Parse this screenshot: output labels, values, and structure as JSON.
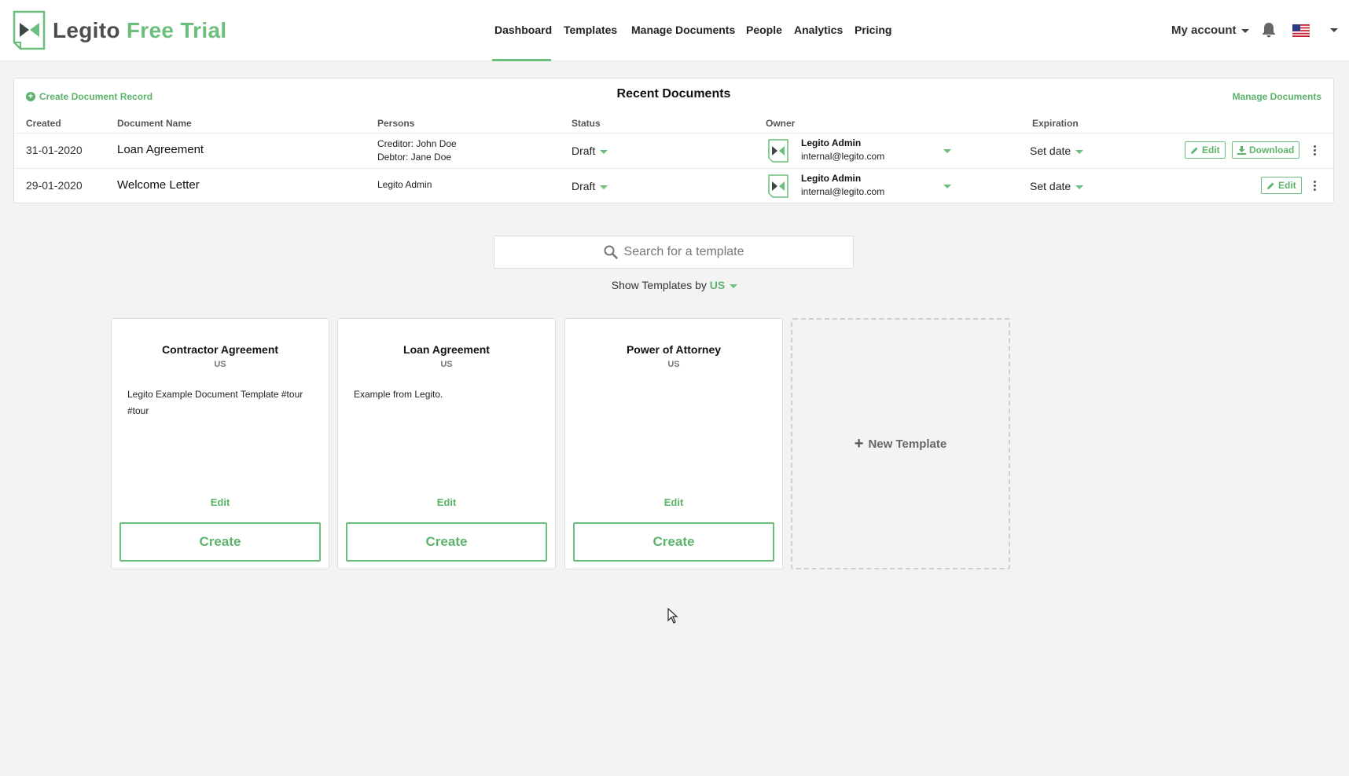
{
  "header": {
    "logo_primary": "Legito",
    "logo_secondary": "Free Trial",
    "nav": [
      {
        "label": "Dashboard",
        "active": true
      },
      {
        "label": "Templates"
      },
      {
        "label": "Manage Documents"
      },
      {
        "label": "People"
      },
      {
        "label": "Analytics"
      },
      {
        "label": "Pricing"
      }
    ],
    "account_label": "My account"
  },
  "recent": {
    "title": "Recent Documents",
    "create_record": "Create Document Record",
    "manage_link": "Manage Documents",
    "columns": [
      "Created",
      "Document Name",
      "Persons",
      "Status",
      "Owner",
      "Expiration"
    ],
    "rows": [
      {
        "created": "31-01-2020",
        "name": "Loan Agreement",
        "persons": [
          "Creditor: John Doe",
          "Debtor: Jane Doe"
        ],
        "status": "Draft",
        "owner_name": "Legito Admin",
        "owner_email": "internal@legito.com",
        "expiration": "Set date",
        "actions": [
          "Edit",
          "Download"
        ]
      },
      {
        "created": "29-01-2020",
        "name": "Welcome Letter",
        "persons": [
          "Legito Admin"
        ],
        "status": "Draft",
        "owner_name": "Legito Admin",
        "owner_email": "internal@legito.com",
        "expiration": "Set date",
        "actions": [
          "Edit"
        ]
      }
    ]
  },
  "search": {
    "placeholder": "Search for a template"
  },
  "filter": {
    "label": "Show Templates by",
    "value": "US"
  },
  "templates": [
    {
      "title": "Contractor Agreement",
      "country": "US",
      "description": "Legito Example Document Template #tour #tour",
      "edit": "Edit",
      "create": "Create"
    },
    {
      "title": "Loan Agreement",
      "country": "US",
      "description": "Example from Legito.",
      "edit": "Edit",
      "create": "Create"
    },
    {
      "title": "Power of Attorney",
      "country": "US",
      "description": "",
      "edit": "Edit",
      "create": "Create"
    }
  ],
  "new_template_label": "New Template",
  "colors": {
    "accent": "#6cbe7c",
    "text": "#222222",
    "background": "#f3f3f3"
  }
}
